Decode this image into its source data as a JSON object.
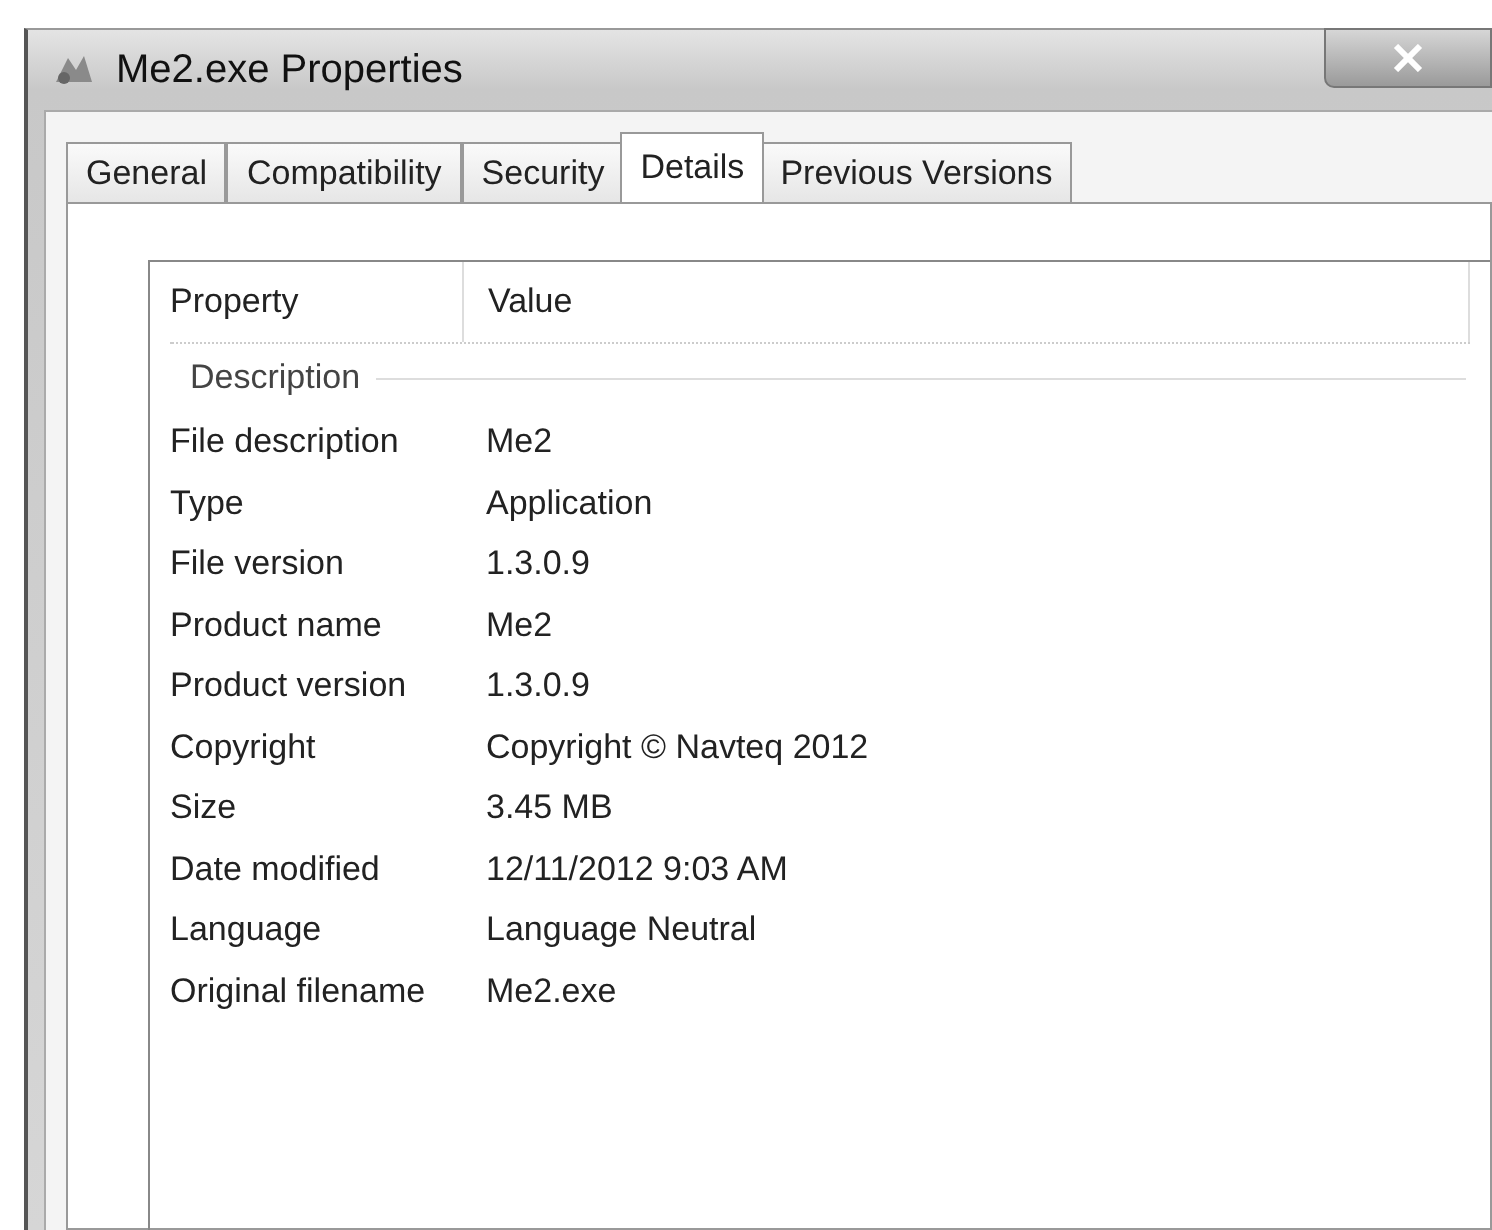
{
  "window": {
    "title": "Me2.exe Properties"
  },
  "tabs": [
    {
      "label": "General",
      "selected": false
    },
    {
      "label": "Compatibility",
      "selected": false
    },
    {
      "label": "Security",
      "selected": false
    },
    {
      "label": "Details",
      "selected": true
    },
    {
      "label": "Previous Versions",
      "selected": false
    }
  ],
  "table": {
    "columns": [
      "Property",
      "Value"
    ],
    "group": "Description",
    "rows": [
      {
        "property": "File description",
        "value": "Me2"
      },
      {
        "property": "Type",
        "value": "Application"
      },
      {
        "property": "File version",
        "value": "1.3.0.9"
      },
      {
        "property": "Product name",
        "value": "Me2"
      },
      {
        "property": "Product version",
        "value": "1.3.0.9"
      },
      {
        "property": "Copyright",
        "value": "Copyright © Navteq 2012"
      },
      {
        "property": "Size",
        "value": "3.45 MB"
      },
      {
        "property": "Date modified",
        "value": "12/11/2012 9:03 AM"
      },
      {
        "property": "Language",
        "value": "Language Neutral"
      },
      {
        "property": "Original filename",
        "value": "Me2.exe"
      }
    ]
  }
}
